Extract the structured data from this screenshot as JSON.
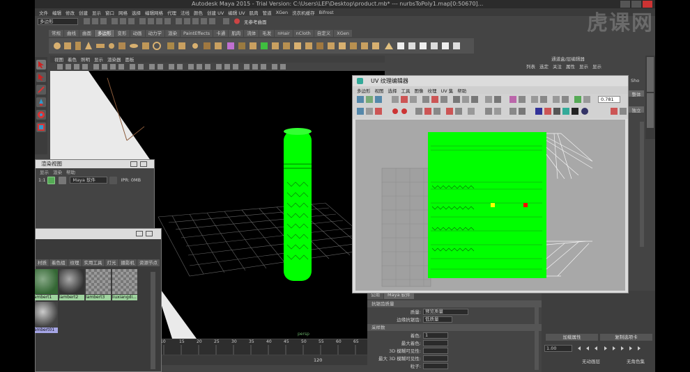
{
  "title_bar": {
    "text": "Autodesk Maya 2015 - Trial Version: C:\\Users\\LEF\\Desktop\\product.mb*  ---  nurbsToPoly1.map[0:50670]..."
  },
  "menu_bar": [
    "文件",
    "编辑",
    "修改",
    "创建",
    "显示",
    "窗口",
    "网格",
    "选择",
    "编辑网格",
    "代理",
    "法线",
    "颜色",
    "创建 UV",
    "编辑 UV",
    "肌肉",
    "管道",
    "XGen",
    "洗衣机缓存",
    "Bifrost"
  ],
  "mode_selector": {
    "value": "多边形"
  },
  "status_line": {
    "hint": "无参考曲面"
  },
  "shelf_tabs": [
    {
      "label": "常规"
    },
    {
      "label": "曲线"
    },
    {
      "label": "曲面"
    },
    {
      "label": "多边形",
      "active": true
    },
    {
      "label": "变形"
    },
    {
      "label": "动画"
    },
    {
      "label": "动力学"
    },
    {
      "label": "渲染"
    },
    {
      "label": "PaintEffects"
    },
    {
      "label": "卡通"
    },
    {
      "label": "肌肉"
    },
    {
      "label": "流体"
    },
    {
      "label": "毛发"
    },
    {
      "label": "nHair"
    },
    {
      "label": "nCloth"
    },
    {
      "label": "自定义"
    },
    {
      "label": "XGen"
    }
  ],
  "viewport": {
    "menu": [
      "视图",
      "着色",
      "照明",
      "显示",
      "渲染器",
      "面板"
    ],
    "camera_label": "persp"
  },
  "render_view": {
    "title": "渲染视图",
    "menu": [
      "显示",
      "渲染",
      "帮助"
    ],
    "ratio": "1:1",
    "renderer": "Maya 软件",
    "ipr": "IPR: 0MB"
  },
  "hypershade": {
    "tabs": [
      "材质",
      "着色组",
      "纹理",
      "实用工具",
      "灯光",
      "摄影机",
      "资源节点"
    ],
    "swatches": [
      "lambert1",
      "lambert2",
      "lambert3",
      "liuxiangdi..."
    ],
    "extra_label": "lambert01"
  },
  "uv_editor": {
    "title": "UV 纹理编辑器",
    "menu": [
      "多边形",
      "视图",
      "选择",
      "工具",
      "图像",
      "纹理",
      "UV 集",
      "帮助"
    ],
    "value_field": "0.781",
    "mesh_color": "#00ff00"
  },
  "attribute_editor": {
    "tabs": [
      {
        "label": "公用"
      },
      {
        "label": "Maya 软件",
        "active": true
      }
    ],
    "section_1": "抗锯齿质量",
    "quality_label": "质量:",
    "quality_value": "预览质量",
    "edge_label": "边缘抗锯齿:",
    "edge_value": "低质量",
    "section_2": "采样数",
    "shading_label": "着色:",
    "shading_value": "1",
    "max_shading_label": "最大着色:",
    "blur_label": "3D 模糊可见性:",
    "max_blur_label": "最大 3D 模糊可见性:",
    "particle_label": "粒子:"
  },
  "channel_box": {
    "header": "通道盒/层编辑器",
    "menu": [
      "列表",
      "选定",
      "关注",
      "属性",
      "显示",
      "显示"
    ],
    "side_value": "Sho",
    "field_labels": [
      "整体",
      "独立"
    ]
  },
  "layer_panel": {
    "btn_attributes": "加载属性",
    "btn_copy": "复制选项卡",
    "frame_value": "1.00",
    "anim_layer": "无动画层",
    "char_set": "无角色集"
  },
  "timeline": {
    "ticks": [
      "10",
      "15",
      "20",
      "25",
      "30",
      "35",
      "40",
      "45",
      "50",
      "55",
      "60",
      "65"
    ],
    "range_end": "120"
  },
  "watermark": {
    "text": "虎课网"
  },
  "colors": {
    "accent_green": "#00ff00",
    "uv_yellow": "#ffff00",
    "uv_red": "#ff0000"
  }
}
